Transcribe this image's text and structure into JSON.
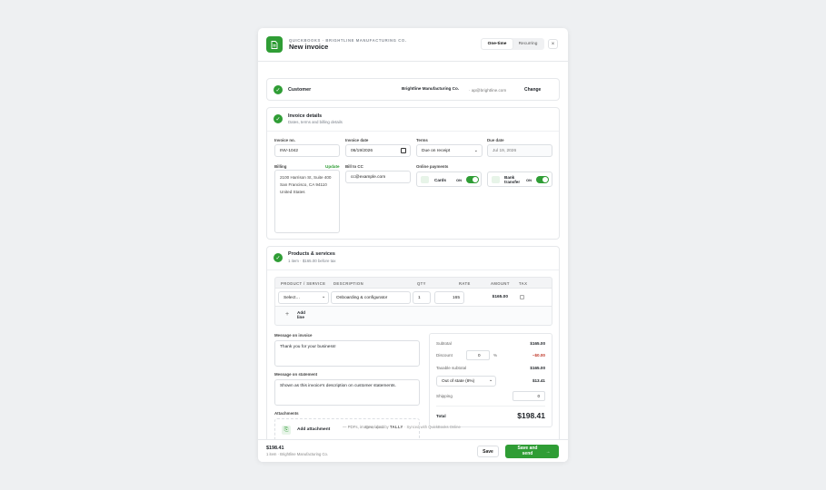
{
  "header": {
    "eyebrow": "QUICKBOOKS · BRIGHTLINE MANUFACTURING CO.",
    "title": "New invoice",
    "tabs": [
      "One-time",
      "Recurring"
    ],
    "close": "×"
  },
  "customer": {
    "label": "Customer",
    "name": "Brightline Manufacturing Co.",
    "email": "ap@brightline.com",
    "change_label": "Change"
  },
  "details": {
    "title": "Invoice details",
    "subtitle": "Dates, terms and billing details",
    "invoice_no_label": "Invoice no.",
    "invoice_no": "INV-1042",
    "invoice_date_label": "Invoice date",
    "invoice_date": "06/19/2026",
    "terms_label": "Terms",
    "terms": "Due on receipt",
    "due_date_label": "Due date",
    "due_date": "Jul 19, 2026",
    "billing_label": "Billing",
    "update_label": "Update",
    "billing_address": [
      "2100 Harrison St, Suite 400",
      "San Francisco, CA 94110",
      "United States"
    ],
    "bill_to_cc_label": "Bill to CC",
    "bill_to_cc_placeholder": "cc@example.com",
    "online_payments_label": "Online payments",
    "cards_label": "Cards",
    "cards_state": "ON",
    "bank_label": "Bank transfer",
    "bank_state": "ON"
  },
  "products": {
    "title": "Products & services",
    "subtitle": "1 item · $165.00 before tax",
    "columns": [
      "PRODUCT / SERVICE",
      "DESCRIPTION",
      "QTY",
      "RATE",
      "AMOUNT",
      "TAX"
    ],
    "row": {
      "product": "Select…",
      "description": "Onboarding & configurator",
      "qty": "1",
      "rate": "165",
      "amount": "$165.00"
    },
    "add_line": "Add line",
    "message_invoice_label": "Message on invoice",
    "message_invoice": "Thank you for your business!",
    "message_statement_label": "Message on statement",
    "message_statement": "Shown as this invoice's description on customer statements.",
    "attachments_label": "Attachments",
    "add_attachment": "Add attachment",
    "attachment_hint": "— PDFs, images, .docx"
  },
  "totals": {
    "subtotal_label": "Subtotal",
    "subtotal": "$165.00",
    "discount_label": "Discount",
    "discount_value": "0",
    "discount_unit": "%",
    "discount_amount": "−$0.00",
    "taxable_label": "Taxable subtotal",
    "taxable": "$165.00",
    "tax_select": "Out of state (8%)",
    "tax_amount": "$13.41",
    "shipping_label": "Shipping",
    "shipping_value": "0",
    "total_label": "Total",
    "total": "$198.41"
  },
  "dev_note": {
    "prefix": "Developed by",
    "brand": "TALLY",
    "suffix": "· Synced with QuickBooks Online"
  },
  "footer": {
    "amount": "$198.41",
    "sub": "1 item · Brightline Manufacturing Co.",
    "save_label": "Save",
    "save_send_label": "Save and send"
  },
  "colors": {
    "accent": "#2f9d35",
    "negative": "#c0392b"
  }
}
